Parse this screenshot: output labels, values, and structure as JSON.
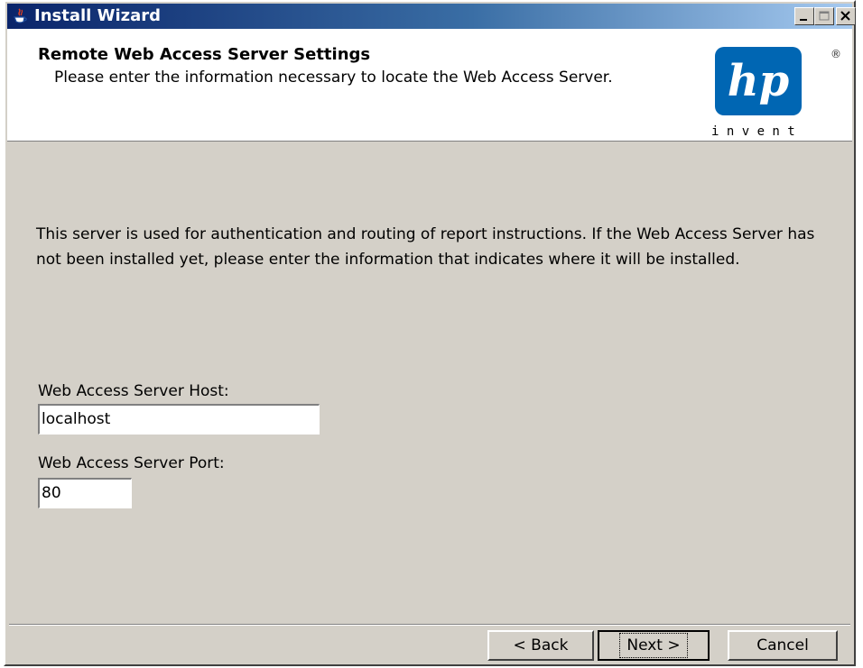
{
  "window": {
    "title": "Install Wizard",
    "buttons": [
      "minimize-icon",
      "maximize-icon",
      "close-icon"
    ]
  },
  "header": {
    "title": "Remote Web Access Server Settings",
    "subtitle": "Please enter the information necessary to locate the Web Access Server.",
    "logo": {
      "brand": "hp",
      "tagline": "i n v e n t",
      "registered": "®"
    }
  },
  "content": {
    "description": "This server is used for authentication and routing of report instructions. If the Web Access Server has not been installed yet, please enter the information that indicates where it will be installed.",
    "host": {
      "label": "Web Access Server Host:",
      "value": "localhost"
    },
    "port": {
      "label": "Web Access Server Port:",
      "value": "80"
    }
  },
  "footer": {
    "back_label": "< Back",
    "next_label": "Next >",
    "cancel_label": "Cancel"
  },
  "colors": {
    "titlebar_start": "#0a246a",
    "titlebar_end": "#a6caf0",
    "dialog_bg": "#d4d0c8",
    "logo_blue": "#0066b3"
  }
}
